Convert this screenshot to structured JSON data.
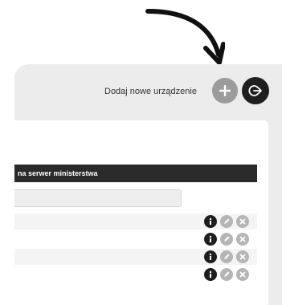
{
  "header": {
    "add_device_label": "Dodaj nowe urządzenie",
    "add_icon": "plus-icon",
    "logout_icon": "logout-icon"
  },
  "table": {
    "header_text": "na serwer ministerstwa",
    "filter_value": "",
    "row_actions": [
      "info-icon",
      "edit-icon",
      "delete-icon"
    ],
    "rows": [
      {},
      {},
      {},
      {}
    ]
  },
  "colors": {
    "panel": "#ececec",
    "table_header": "#2a2a2a",
    "add_button": "#9b9b9b",
    "logout_button": "#1f1f1f",
    "action_icon": "#b5b5b5"
  }
}
